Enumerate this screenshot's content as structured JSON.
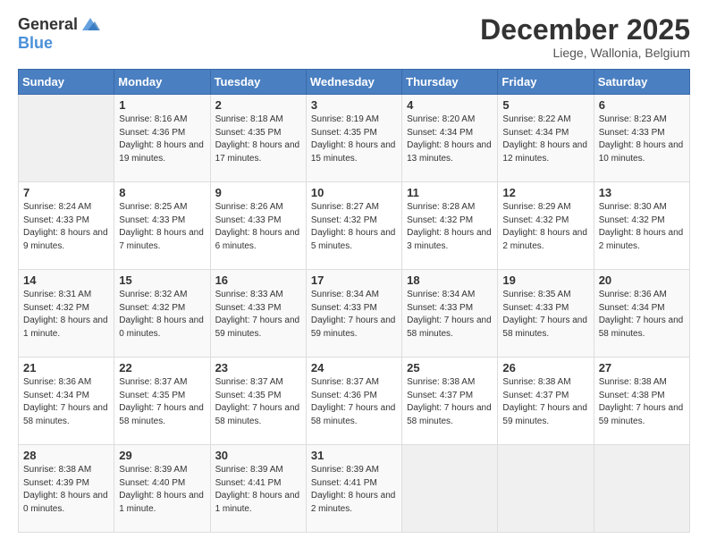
{
  "header": {
    "logo_general": "General",
    "logo_blue": "Blue",
    "month": "December 2025",
    "location": "Liege, Wallonia, Belgium"
  },
  "weekdays": [
    "Sunday",
    "Monday",
    "Tuesday",
    "Wednesday",
    "Thursday",
    "Friday",
    "Saturday"
  ],
  "weeks": [
    [
      {
        "day": "",
        "empty": true
      },
      {
        "day": "1",
        "sunrise": "Sunrise: 8:16 AM",
        "sunset": "Sunset: 4:36 PM",
        "daylight": "Daylight: 8 hours and 19 minutes."
      },
      {
        "day": "2",
        "sunrise": "Sunrise: 8:18 AM",
        "sunset": "Sunset: 4:35 PM",
        "daylight": "Daylight: 8 hours and 17 minutes."
      },
      {
        "day": "3",
        "sunrise": "Sunrise: 8:19 AM",
        "sunset": "Sunset: 4:35 PM",
        "daylight": "Daylight: 8 hours and 15 minutes."
      },
      {
        "day": "4",
        "sunrise": "Sunrise: 8:20 AM",
        "sunset": "Sunset: 4:34 PM",
        "daylight": "Daylight: 8 hours and 13 minutes."
      },
      {
        "day": "5",
        "sunrise": "Sunrise: 8:22 AM",
        "sunset": "Sunset: 4:34 PM",
        "daylight": "Daylight: 8 hours and 12 minutes."
      },
      {
        "day": "6",
        "sunrise": "Sunrise: 8:23 AM",
        "sunset": "Sunset: 4:33 PM",
        "daylight": "Daylight: 8 hours and 10 minutes."
      }
    ],
    [
      {
        "day": "7",
        "sunrise": "Sunrise: 8:24 AM",
        "sunset": "Sunset: 4:33 PM",
        "daylight": "Daylight: 8 hours and 9 minutes."
      },
      {
        "day": "8",
        "sunrise": "Sunrise: 8:25 AM",
        "sunset": "Sunset: 4:33 PM",
        "daylight": "Daylight: 8 hours and 7 minutes."
      },
      {
        "day": "9",
        "sunrise": "Sunrise: 8:26 AM",
        "sunset": "Sunset: 4:33 PM",
        "daylight": "Daylight: 8 hours and 6 minutes."
      },
      {
        "day": "10",
        "sunrise": "Sunrise: 8:27 AM",
        "sunset": "Sunset: 4:32 PM",
        "daylight": "Daylight: 8 hours and 5 minutes."
      },
      {
        "day": "11",
        "sunrise": "Sunrise: 8:28 AM",
        "sunset": "Sunset: 4:32 PM",
        "daylight": "Daylight: 8 hours and 3 minutes."
      },
      {
        "day": "12",
        "sunrise": "Sunrise: 8:29 AM",
        "sunset": "Sunset: 4:32 PM",
        "daylight": "Daylight: 8 hours and 2 minutes."
      },
      {
        "day": "13",
        "sunrise": "Sunrise: 8:30 AM",
        "sunset": "Sunset: 4:32 PM",
        "daylight": "Daylight: 8 hours and 2 minutes."
      }
    ],
    [
      {
        "day": "14",
        "sunrise": "Sunrise: 8:31 AM",
        "sunset": "Sunset: 4:32 PM",
        "daylight": "Daylight: 8 hours and 1 minute."
      },
      {
        "day": "15",
        "sunrise": "Sunrise: 8:32 AM",
        "sunset": "Sunset: 4:32 PM",
        "daylight": "Daylight: 8 hours and 0 minutes."
      },
      {
        "day": "16",
        "sunrise": "Sunrise: 8:33 AM",
        "sunset": "Sunset: 4:33 PM",
        "daylight": "Daylight: 7 hours and 59 minutes."
      },
      {
        "day": "17",
        "sunrise": "Sunrise: 8:34 AM",
        "sunset": "Sunset: 4:33 PM",
        "daylight": "Daylight: 7 hours and 59 minutes."
      },
      {
        "day": "18",
        "sunrise": "Sunrise: 8:34 AM",
        "sunset": "Sunset: 4:33 PM",
        "daylight": "Daylight: 7 hours and 58 minutes."
      },
      {
        "day": "19",
        "sunrise": "Sunrise: 8:35 AM",
        "sunset": "Sunset: 4:33 PM",
        "daylight": "Daylight: 7 hours and 58 minutes."
      },
      {
        "day": "20",
        "sunrise": "Sunrise: 8:36 AM",
        "sunset": "Sunset: 4:34 PM",
        "daylight": "Daylight: 7 hours and 58 minutes."
      }
    ],
    [
      {
        "day": "21",
        "sunrise": "Sunrise: 8:36 AM",
        "sunset": "Sunset: 4:34 PM",
        "daylight": "Daylight: 7 hours and 58 minutes."
      },
      {
        "day": "22",
        "sunrise": "Sunrise: 8:37 AM",
        "sunset": "Sunset: 4:35 PM",
        "daylight": "Daylight: 7 hours and 58 minutes."
      },
      {
        "day": "23",
        "sunrise": "Sunrise: 8:37 AM",
        "sunset": "Sunset: 4:35 PM",
        "daylight": "Daylight: 7 hours and 58 minutes."
      },
      {
        "day": "24",
        "sunrise": "Sunrise: 8:37 AM",
        "sunset": "Sunset: 4:36 PM",
        "daylight": "Daylight: 7 hours and 58 minutes."
      },
      {
        "day": "25",
        "sunrise": "Sunrise: 8:38 AM",
        "sunset": "Sunset: 4:37 PM",
        "daylight": "Daylight: 7 hours and 58 minutes."
      },
      {
        "day": "26",
        "sunrise": "Sunrise: 8:38 AM",
        "sunset": "Sunset: 4:37 PM",
        "daylight": "Daylight: 7 hours and 59 minutes."
      },
      {
        "day": "27",
        "sunrise": "Sunrise: 8:38 AM",
        "sunset": "Sunset: 4:38 PM",
        "daylight": "Daylight: 7 hours and 59 minutes."
      }
    ],
    [
      {
        "day": "28",
        "sunrise": "Sunrise: 8:38 AM",
        "sunset": "Sunset: 4:39 PM",
        "daylight": "Daylight: 8 hours and 0 minutes."
      },
      {
        "day": "29",
        "sunrise": "Sunrise: 8:39 AM",
        "sunset": "Sunset: 4:40 PM",
        "daylight": "Daylight: 8 hours and 1 minute."
      },
      {
        "day": "30",
        "sunrise": "Sunrise: 8:39 AM",
        "sunset": "Sunset: 4:41 PM",
        "daylight": "Daylight: 8 hours and 1 minute."
      },
      {
        "day": "31",
        "sunrise": "Sunrise: 8:39 AM",
        "sunset": "Sunset: 4:41 PM",
        "daylight": "Daylight: 8 hours and 2 minutes."
      },
      {
        "day": "",
        "empty": true
      },
      {
        "day": "",
        "empty": true
      },
      {
        "day": "",
        "empty": true
      }
    ]
  ]
}
